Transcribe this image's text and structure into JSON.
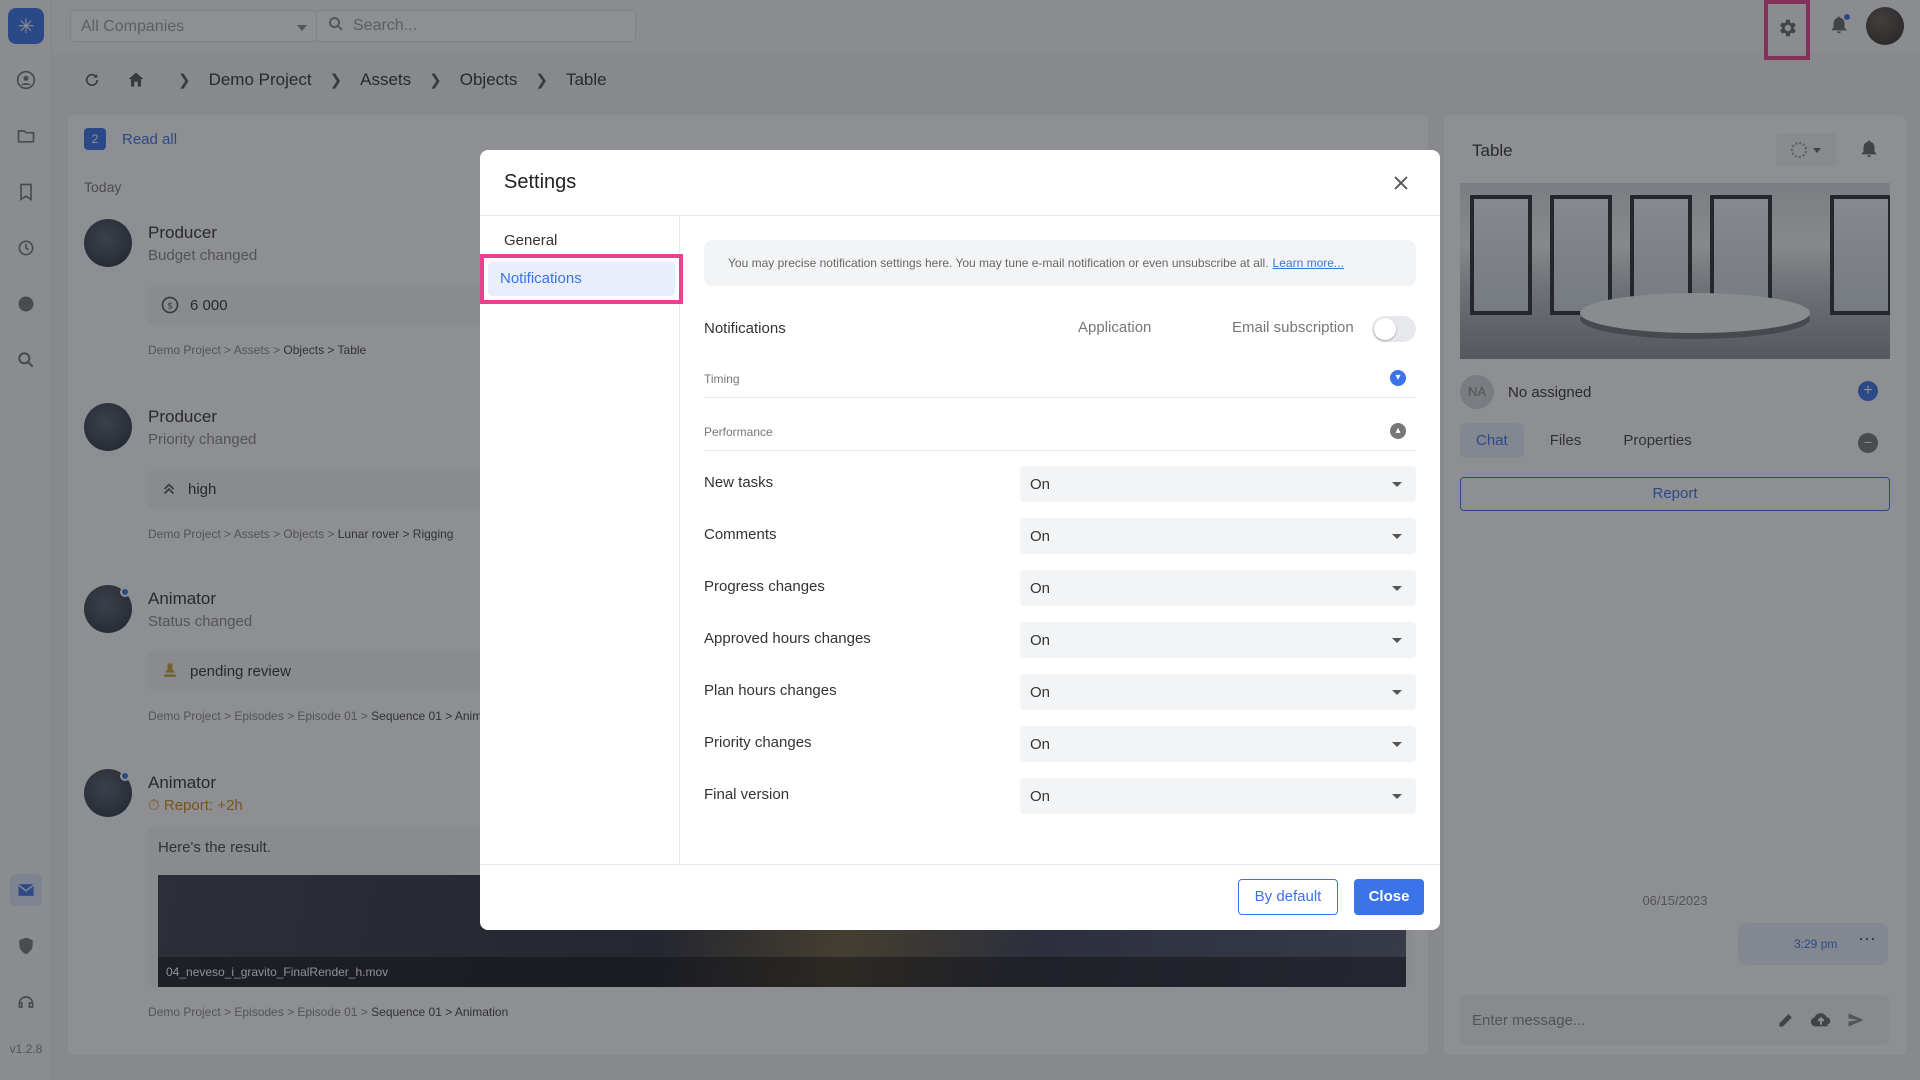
{
  "app": {
    "version": "v1.2.8"
  },
  "topbar": {
    "company_select": "All Companies",
    "search_placeholder": "Search..."
  },
  "breadcrumb": [
    "Demo Project",
    "Assets",
    "Objects",
    "Table"
  ],
  "feed": {
    "unread_count": "2",
    "read_all_label": "Read all",
    "day_label": "Today",
    "events": [
      {
        "name": "Producer",
        "subtitle": "Budget changed",
        "value": "6 000",
        "path_prefix": "Demo Project > Assets > ",
        "path_tail": "Objects > Table"
      },
      {
        "name": "Producer",
        "subtitle": "Priority changed",
        "value": "high",
        "path_prefix": "Demo Project > Assets > Objects > ",
        "path_tail": "Lunar rover > Rigging"
      },
      {
        "name": "Animator",
        "subtitle": "Status changed",
        "value": "pending review",
        "path_prefix": "Demo Project > Episodes > Episode 01 > ",
        "path_tail": "Sequence 01 > Anim"
      },
      {
        "name": "Animator",
        "subtitle": "Report: +2h",
        "text": "Here's the result.",
        "video_name": "04_neveso_i_gravito_FinalRender_h.mov",
        "path_prefix": "Demo Project > Episodes > Episode 01 > ",
        "path_tail": "Sequence 01 > Animation"
      }
    ]
  },
  "right_panel": {
    "title": "Table",
    "assignee": "No assigned",
    "assignee_initials": "NA",
    "tabs": [
      "Chat",
      "Files",
      "Properties"
    ],
    "report_button": "Report",
    "chat_date": "06/15/2023",
    "message_time": "3:29 pm",
    "message_placeholder": "Enter message..."
  },
  "settings_modal": {
    "title": "Settings",
    "nav": [
      "General",
      "Notifications"
    ],
    "info_text": "You may precise notification settings here. You may tune e-mail notification or even unsubscribe at all.",
    "learn_more": "Learn more...",
    "notifications_label": "Notifications",
    "application_label": "Application",
    "email_label": "Email subscription",
    "email_subscription_on": false,
    "sections": [
      "Timing",
      "Performance"
    ],
    "rows": [
      {
        "label": "New tasks",
        "value": "On"
      },
      {
        "label": "Comments",
        "value": "On"
      },
      {
        "label": "Progress changes",
        "value": "On"
      },
      {
        "label": "Approved hours changes",
        "value": "On"
      },
      {
        "label": "Plan hours changes",
        "value": "On"
      },
      {
        "label": "Priority changes",
        "value": "On"
      },
      {
        "label": "Final version",
        "value": "On"
      }
    ],
    "default_button": "By default",
    "close_button": "Close"
  },
  "colors": {
    "accent": "#3b73e8",
    "highlight": "#e8418f",
    "report": "#d08a1b"
  }
}
